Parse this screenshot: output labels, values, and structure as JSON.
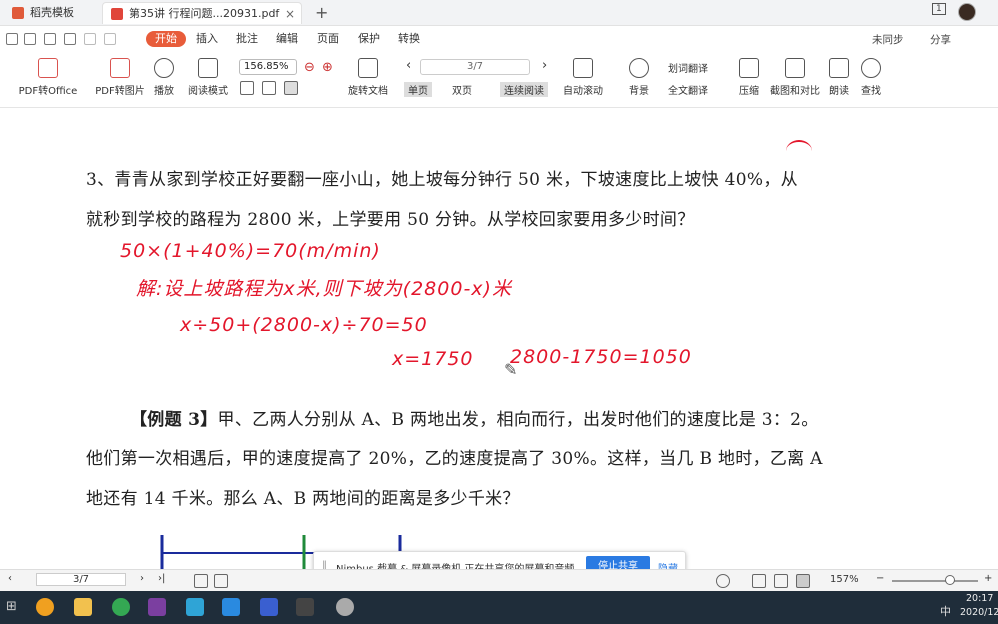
{
  "tabs": [
    {
      "label": "稻壳模板",
      "color": "#e05a3a"
    },
    {
      "label": "第35讲 行程问题...20931.pdf",
      "color": "#e0453a"
    }
  ],
  "window": {
    "page_indicator": "1"
  },
  "menu": {
    "items": [
      "开始",
      "插入",
      "批注",
      "编辑",
      "页面",
      "保护",
      "转换"
    ],
    "active": "开始",
    "sync": "未同步",
    "share": "分享"
  },
  "ribbon": {
    "pdf_office": "PDF转Office",
    "pdf_image": "PDF转图片",
    "play": "播放",
    "read_mode": "阅读模式",
    "zoom": "156.85%",
    "rotate": "旋转文档",
    "page": "3/7",
    "single": "单页",
    "double": "双页",
    "continuous": "连续阅读",
    "autoscroll": "自动滚动",
    "background": "背景",
    "word_translate": "划词翻译",
    "full_translate": "全文翻译",
    "compress": "压缩",
    "screenshot": "截图和对比",
    "read_aloud": "朗读",
    "find": "查找"
  },
  "doc": {
    "q3_line1": "3、青青从家到学校正好要翻一座小山，她上坡每分钟行 50 米，下坡速度比上坡快 40%，从",
    "q3_line2": "就秒到学校的路程为 2800 米，上学要用 50 分钟。从学校回家要用多少时间？",
    "hw1": "50×(1+40%)=70(m/min)",
    "hw2": "解:设上坡路程为x米,则下坡为(2800-x)米",
    "hw3": "x÷50+(2800-x)÷70=50",
    "hw4": "x=1750",
    "hw5": "2800-1750=1050",
    "ex3_title": "【例题 3】",
    "ex3_line1": "甲、乙两人分别从 A、B 两地出发，相向而行，出发时他们的速度比是 3：2。",
    "ex3_line2": "他们第一次相遇后，甲的速度提高了 20%，乙的速度提高了 30%。这样，当几 B 地时，乙离 A",
    "ex3_line3": "地还有 14 千米。那么 A、B 两地间的距离是多少千米？"
  },
  "share_bar": {
    "text": "Nimbus 截幕 & 屏幕录像机 正在共享您的屏幕和音频。",
    "stop": "停止共享",
    "hide": "隐藏"
  },
  "status": {
    "page": "3/7",
    "zoom": "157%"
  },
  "taskbar": {
    "time": "20:17",
    "date": "2020/12",
    "lang": "中"
  },
  "colors": {
    "accent": "#e85c3a",
    "ink": "#e3162b",
    "taskbar": "#1f2d3a",
    "share_blue": "#2a7ae2"
  }
}
